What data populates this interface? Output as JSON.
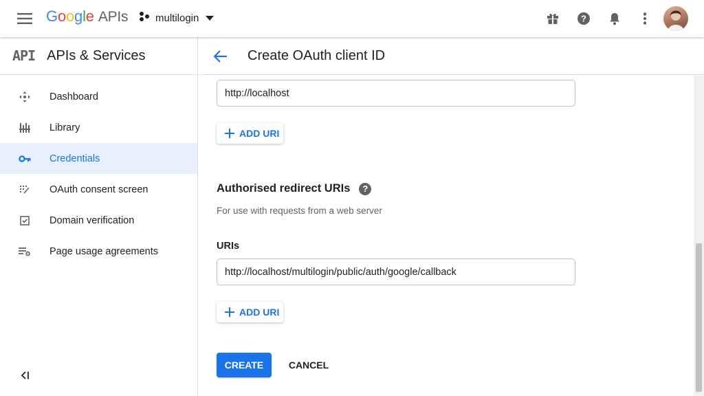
{
  "topbar": {
    "logo_google": [
      "G",
      "o",
      "o",
      "g",
      "l",
      "e"
    ],
    "logo_apis": "APIs",
    "project_name": "multilogin",
    "icons": [
      "gift-icon",
      "help-icon",
      "notifications-icon",
      "more-vert-icon"
    ]
  },
  "sidebar": {
    "badge": "API",
    "title": "APIs & Services",
    "items": [
      {
        "label": "Dashboard",
        "icon": "dashboard-icon",
        "active": false
      },
      {
        "label": "Library",
        "icon": "library-icon",
        "active": false
      },
      {
        "label": "Credentials",
        "icon": "key-icon",
        "active": true
      },
      {
        "label": "OAuth consent screen",
        "icon": "consent-icon",
        "active": false
      },
      {
        "label": "Domain verification",
        "icon": "checkbox-icon",
        "active": false
      },
      {
        "label": "Page usage agreements",
        "icon": "settings-list-icon",
        "active": false
      }
    ],
    "collapse_glyph": "<I"
  },
  "main": {
    "title": "Create OAuth client ID",
    "origin_uri_value": "http://localhost",
    "add_uri_label": "ADD URI",
    "redirect_section_title": "Authorised redirect URIs",
    "redirect_section_desc": "For use with requests from a web server",
    "uris_label": "URIs",
    "redirect_uri_value": "http://localhost/multilogin/public/auth/google/callback",
    "create_label": "CREATE",
    "cancel_label": "CANCEL"
  },
  "colors": {
    "accent": "#1a73e8",
    "active_bg": "#e8f0fe",
    "icon_grey": "#5f6368"
  }
}
